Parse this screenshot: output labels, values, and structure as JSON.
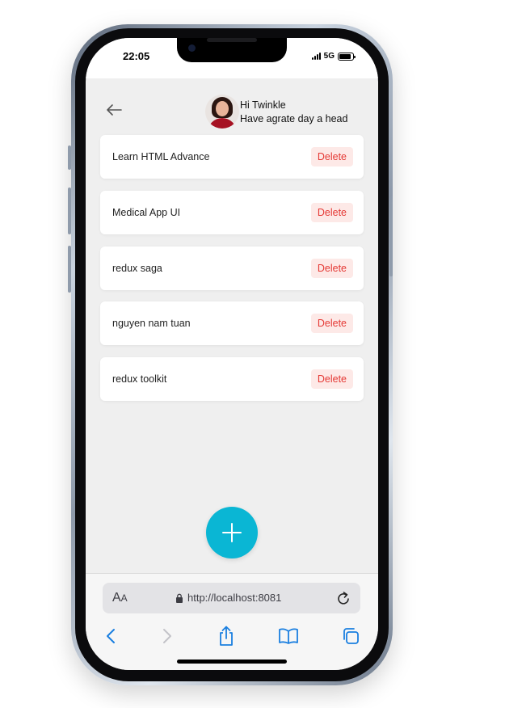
{
  "status_bar": {
    "time": "22:05",
    "network": "5G"
  },
  "header": {
    "greeting": "Hi Twinkle",
    "subtitle": "Have agrate day a head"
  },
  "todos": [
    {
      "text": "Learn HTML Advance",
      "action": "Delete"
    },
    {
      "text": "Medical App UI",
      "action": "Delete"
    },
    {
      "text": "redux saga",
      "action": "Delete"
    },
    {
      "text": "nguyen nam tuan",
      "action": "Delete"
    },
    {
      "text": "redux toolkit",
      "action": "Delete"
    }
  ],
  "safari": {
    "aa_label": "A",
    "aa_small": "A",
    "url": "http://localhost:8081"
  },
  "colors": {
    "accent": "#0ab6d4",
    "delete_text": "#e53935",
    "delete_bg": "#fde9e7",
    "safari_blue": "#007aff"
  },
  "icons": {
    "back": "arrow-left-icon",
    "add": "plus-icon",
    "lock": "lock-icon",
    "reload": "reload-icon"
  }
}
